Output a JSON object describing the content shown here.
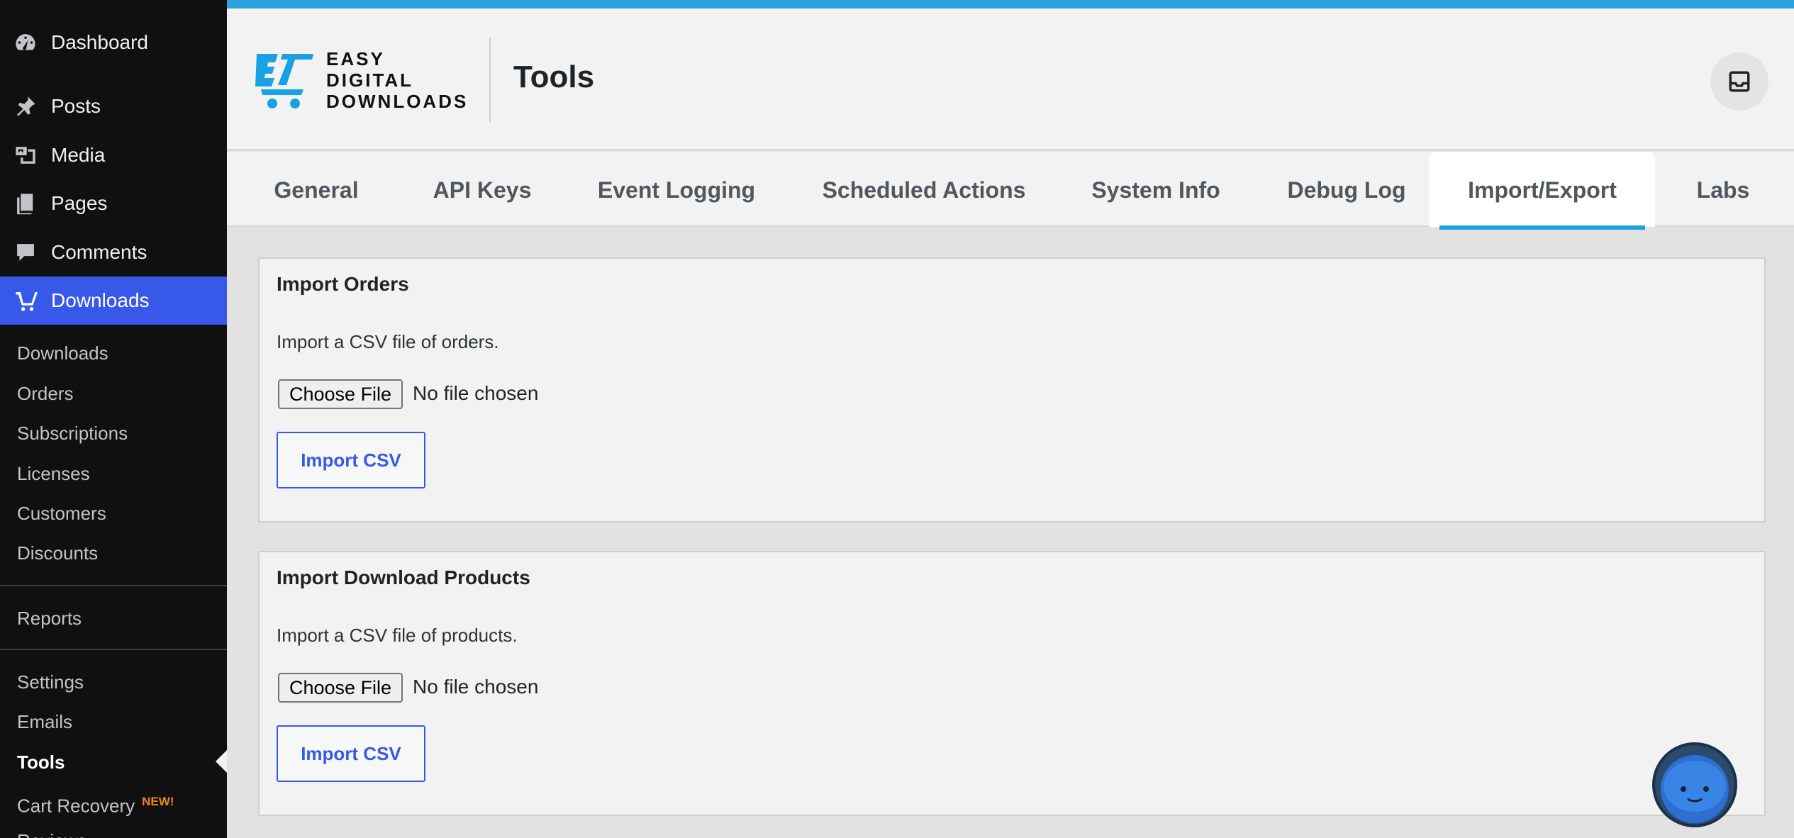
{
  "sidebar": {
    "top_items": [
      {
        "label": "Dashboard",
        "icon": "dashboard-icon"
      },
      {
        "label": "Posts",
        "icon": "pushpin-icon"
      },
      {
        "label": "Media",
        "icon": "media-icon"
      },
      {
        "label": "Pages",
        "icon": "pages-icon"
      },
      {
        "label": "Comments",
        "icon": "comment-icon"
      },
      {
        "label": "Downloads",
        "icon": "edd-logo-icon"
      }
    ],
    "submenu": {
      "group1": [
        "Downloads",
        "Orders",
        "Subscriptions",
        "Licenses",
        "Customers",
        "Discounts"
      ],
      "group2": [
        "Reports"
      ],
      "group3": [
        "Settings",
        "Emails",
        "Tools",
        "Cart Recovery",
        "Reviews"
      ],
      "new_badge": "NEW!",
      "current": "Tools"
    }
  },
  "header": {
    "brand_lines": [
      "EASY",
      "DIGITAL",
      "DOWNLOADS"
    ],
    "title": "Tools",
    "inbox_icon": "inbox-icon",
    "accent_color": "#2ea2e0"
  },
  "tabs": [
    {
      "label": "General"
    },
    {
      "label": "API Keys"
    },
    {
      "label": "Event Logging"
    },
    {
      "label": "Scheduled Actions"
    },
    {
      "label": "System Info"
    },
    {
      "label": "Debug Log"
    },
    {
      "label": "Import/Export",
      "active": true
    },
    {
      "label": "Labs"
    }
  ],
  "panels": {
    "orders": {
      "title": "Import Orders",
      "description": "Import a CSV file of orders.",
      "file_button": "Choose File",
      "file_status": "No file chosen",
      "import_button": "Import CSV"
    },
    "products": {
      "title": "Import Download Products",
      "description": "Import a CSV file of products.",
      "file_button": "Choose File",
      "file_status": "No file chosen",
      "import_button": "Import CSV"
    }
  },
  "colors": {
    "sidebar_bg": "#101010",
    "active_menu": "#3858e9",
    "link_blue": "#3858e9",
    "new_badge": "#f0821e"
  }
}
